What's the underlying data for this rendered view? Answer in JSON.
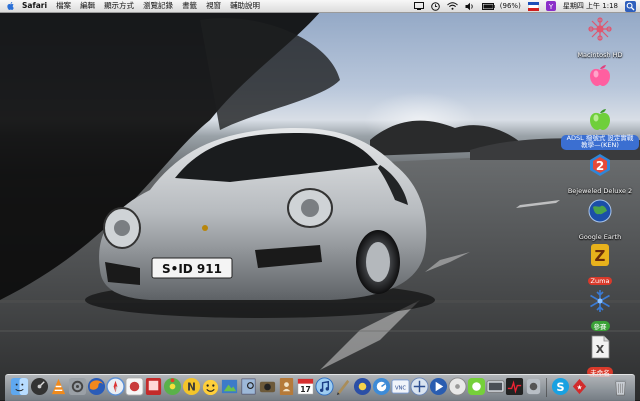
{
  "menubar": {
    "app_name": "Safari",
    "items": [
      "檔案",
      "編輯",
      "顯示方式",
      "瀏覽記錄",
      "書籤",
      "視窗",
      "輔助說明"
    ],
    "status": {
      "battery_text": "(96%)",
      "clock": "星期四 上午 1:18"
    }
  },
  "wallpaper": {
    "license_plate": "S•ID 911"
  },
  "desktop_icons": [
    {
      "label": "Macintosh HD",
      "icon": "macintosh-hd-icon"
    },
    {
      "label": "",
      "icon": "apple-pink-icon"
    },
    {
      "label": "ADSL 撥號式 設定實戰教學—(KEN)",
      "icon": "apple-green-icon",
      "highlight": "#3b6fd1"
    },
    {
      "label": "Bejeweled Deluxe 2",
      "icon": "bejeweled-icon"
    },
    {
      "label": "Google Earth",
      "icon": "google-earth-icon"
    },
    {
      "label": "Zuma",
      "icon": "zuma-icon",
      "highlight": "#d93a2b"
    },
    {
      "label": "參賽",
      "icon": "snowflake-icon",
      "highlight": "#3aa236"
    },
    {
      "label": "未命名",
      "icon": "document-icon",
      "highlight": "#d93a2b"
    }
  ],
  "dock": {
    "items": [
      {
        "name": "finder"
      },
      {
        "name": "dashboard"
      },
      {
        "name": "vlc"
      },
      {
        "name": "system-preferences"
      },
      {
        "name": "firefox"
      },
      {
        "name": "safari"
      },
      {
        "name": "camino"
      },
      {
        "name": "photo-booth"
      },
      {
        "name": "icq"
      },
      {
        "name": "msn-messenger"
      },
      {
        "name": "adium"
      },
      {
        "name": "iphoto"
      },
      {
        "name": "preview"
      },
      {
        "name": "image-capture"
      },
      {
        "name": "address-book"
      },
      {
        "name": "ical"
      },
      {
        "name": "itunes"
      },
      {
        "name": "script-editor"
      },
      {
        "name": "mac-the-ripper"
      },
      {
        "name": "qq"
      },
      {
        "name": "bittorrent"
      },
      {
        "name": "network-tool"
      },
      {
        "name": "quicktime"
      },
      {
        "name": "dvd-player"
      },
      {
        "name": "media-app"
      },
      {
        "name": "skype"
      },
      {
        "name": "cycle-app"
      },
      {
        "name": "activity-monitor"
      },
      {
        "name": "recorder"
      },
      {
        "name": "skype-blue"
      },
      {
        "name": "poker-app"
      },
      {
        "name": "trash"
      }
    ]
  }
}
